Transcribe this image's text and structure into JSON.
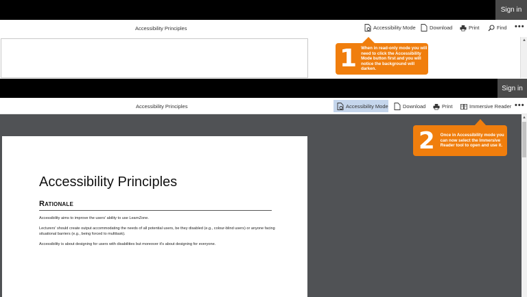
{
  "top_panel": {
    "sign_in_label": "Sign in",
    "doc_title": "Accessibility Principles",
    "toolbar": {
      "accessibility_mode": "Accessibility Mode",
      "download": "Download",
      "print": "Print",
      "find": "Find",
      "more": "•••"
    },
    "scroll_up": "▲"
  },
  "callout_1": {
    "number": "1",
    "text": "When in read-only mode you will need to click the Accessibility Mode button first and you will notice the background will darken."
  },
  "bottom_panel": {
    "sign_in_label": "Sign in",
    "doc_title": "Accessibility Principles",
    "toolbar": {
      "accessibility_mode": "Accessibility Mode",
      "download": "Download",
      "print": "Print",
      "immersive_reader": "Immersive Reader",
      "more": "•••"
    },
    "scroll_up": "▲",
    "document": {
      "heading": "Accessibility Principles",
      "section_title": "Rationale",
      "paragraphs": [
        "Accessibility aims to improve the users' ability to use LearnZone.",
        "Lecturers' should create output accommodating the needs of all potential users, be they disabled (e.g., colour-blind users) or anyone facing situational barriers (e.g., being forced to multitask).",
        "Accessibility is about designing for users with disabilities but moreover it's about designing for everyone."
      ]
    }
  },
  "callout_2": {
    "number": "2",
    "text": "Once in Accessibility mode you can now select the Immersive Reader tool to open and use it."
  },
  "colors": {
    "callout": "#f07e0d",
    "top_bar": "#000000",
    "reader_background": "#505255",
    "active_button": "#c5d6ec"
  },
  "icons": {
    "accessibility_mode": "document-settings-icon",
    "download": "document-icon",
    "print": "printer-icon",
    "find": "search-icon",
    "immersive_reader": "book-icon"
  }
}
